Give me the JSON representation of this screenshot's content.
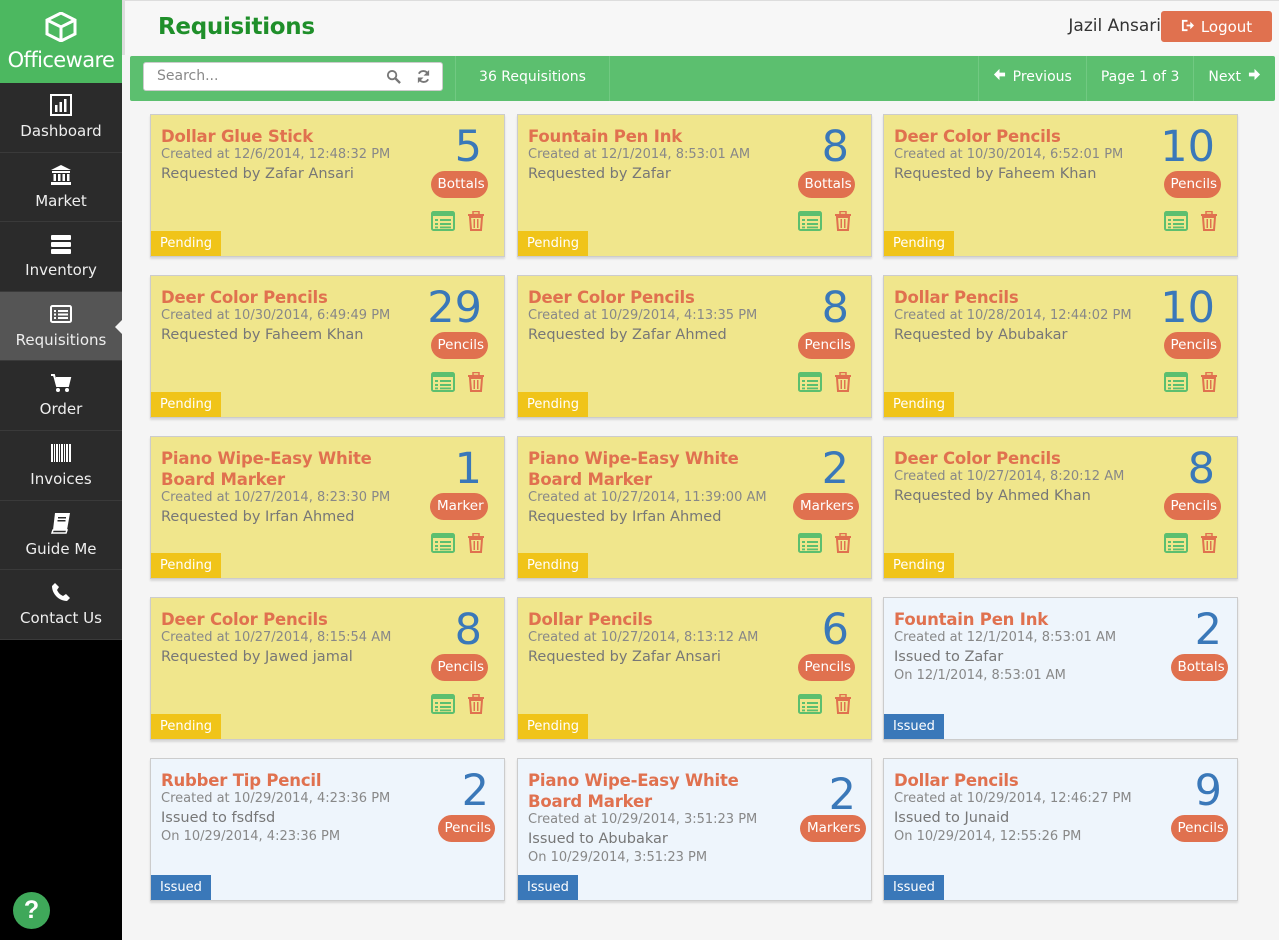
{
  "brand": {
    "name": "Officeware"
  },
  "nav": [
    {
      "label": "Dashboard",
      "icon": "dashboard-icon"
    },
    {
      "label": "Market",
      "icon": "bank-icon"
    },
    {
      "label": "Inventory",
      "icon": "server-icon"
    },
    {
      "label": "Requisitions",
      "icon": "list-icon",
      "active": true
    },
    {
      "label": "Order",
      "icon": "cart-icon"
    },
    {
      "label": "Invoices",
      "icon": "barcode-icon"
    },
    {
      "label": "Guide Me",
      "icon": "book-icon"
    },
    {
      "label": "Contact Us",
      "icon": "phone-icon"
    }
  ],
  "help": {
    "label": "?"
  },
  "header": {
    "title": "Requisitions",
    "user": "Jazil Ansari",
    "logout_label": "Logout"
  },
  "toolbar": {
    "search_placeholder": "Search...",
    "count_label": "36 Requisitions",
    "previous_label": "Previous",
    "page_label": "Page 1 of 3",
    "next_label": "Next"
  },
  "colors": {
    "brand_green": "#4cb860",
    "toolbar_green": "#5cbf6f",
    "accent_orange": "#e0714f",
    "qty_blue": "#3a78b9",
    "pending": "#f0c419",
    "issued": "#3a78b9"
  },
  "cards": [
    {
      "title": "Dollar Glue Stick",
      "created": "Created at 12/6/2014, 12:48:32 PM",
      "by": "Requested by Zafar Ansari",
      "qty": "5",
      "unit": "Bottals",
      "status": "Pending"
    },
    {
      "title": "Fountain Pen Ink",
      "created": "Created at 12/1/2014, 8:53:01 AM",
      "by": "Requested by Zafar",
      "qty": "8",
      "unit": "Bottals",
      "status": "Pending"
    },
    {
      "title": "Deer Color Pencils",
      "created": "Created at 10/30/2014, 6:52:01 PM",
      "by": "Requested by Faheem Khan",
      "qty": "10",
      "unit": "Pencils",
      "status": "Pending"
    },
    {
      "title": "Deer Color Pencils",
      "created": "Created at 10/30/2014, 6:49:49 PM",
      "by": "Requested by Faheem Khan",
      "qty": "29",
      "unit": "Pencils",
      "status": "Pending"
    },
    {
      "title": "Deer Color Pencils",
      "created": "Created at 10/29/2014, 4:13:35 PM",
      "by": "Requested by Zafar Ahmed",
      "qty": "8",
      "unit": "Pencils",
      "status": "Pending"
    },
    {
      "title": "Dollar Pencils",
      "created": "Created at 10/28/2014, 12:44:02 PM",
      "by": "Requested by Abubakar",
      "qty": "10",
      "unit": "Pencils",
      "status": "Pending"
    },
    {
      "title": "Piano Wipe-Easy White Board Marker",
      "created": "Created at 10/27/2014, 8:23:30 PM",
      "by": "Requested by Irfan Ahmed",
      "qty": "1",
      "unit": "Marker",
      "status": "Pending"
    },
    {
      "title": "Piano Wipe-Easy White Board Marker",
      "created": "Created at 10/27/2014, 11:39:00 AM",
      "by": "Requested by Irfan Ahmed",
      "qty": "2",
      "unit": "Markers",
      "status": "Pending"
    },
    {
      "title": "Deer Color Pencils",
      "created": "Created at 10/27/2014, 8:20:12 AM",
      "by": "Requested by Ahmed Khan",
      "qty": "8",
      "unit": "Pencils",
      "status": "Pending"
    },
    {
      "title": "Deer Color Pencils",
      "created": "Created at 10/27/2014, 8:15:54 AM",
      "by": "Requested by Jawed jamal",
      "qty": "8",
      "unit": "Pencils",
      "status": "Pending"
    },
    {
      "title": "Dollar Pencils",
      "created": "Created at 10/27/2014, 8:13:12 AM",
      "by": "Requested by Zafar Ansari",
      "qty": "6",
      "unit": "Pencils",
      "status": "Pending"
    },
    {
      "title": "Fountain Pen Ink",
      "created": "Created at 12/1/2014, 8:53:01 AM",
      "by": "Issued to Zafar",
      "on": "On 12/1/2014, 8:53:01 AM",
      "qty": "2",
      "unit": "Bottals",
      "status": "Issued"
    },
    {
      "title": "Rubber Tip Pencil",
      "created": "Created at 10/29/2014, 4:23:36 PM",
      "by": "Issued to fsdfsd",
      "on": "On 10/29/2014, 4:23:36 PM",
      "qty": "2",
      "unit": "Pencils",
      "status": "Issued"
    },
    {
      "title": "Piano Wipe-Easy White Board Marker",
      "created": "Created at 10/29/2014, 3:51:23 PM",
      "by": "Issued to Abubakar",
      "on": "On 10/29/2014, 3:51:23 PM",
      "qty": "2",
      "unit": "Markers",
      "status": "Issued"
    },
    {
      "title": "Dollar Pencils",
      "created": "Created at 10/29/2014, 12:46:27 PM",
      "by": "Issued to Junaid",
      "on": "On 10/29/2014, 12:55:26 PM",
      "qty": "9",
      "unit": "Pencils",
      "status": "Issued"
    }
  ]
}
